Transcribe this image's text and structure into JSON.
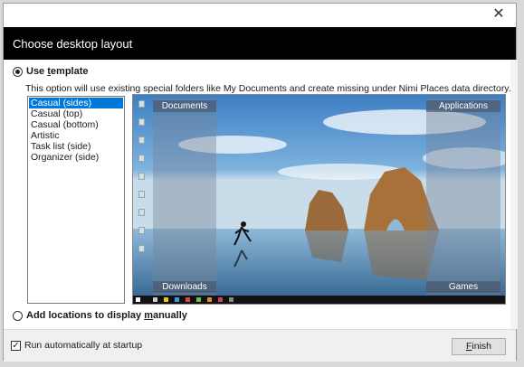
{
  "dialog": {
    "title": "Choose desktop layout"
  },
  "template_option": {
    "label_prefix": "Use ",
    "label_accel": "t",
    "label_suffix": "emplate",
    "selected": true,
    "description": "This option will use existing special folders like My Documents and create missing under Nimi Places data directory."
  },
  "layouts": {
    "items": [
      "Casual (sides)",
      "Casual (top)",
      "Casual (bottom)",
      "Artistic",
      "Task list (side)",
      "Organizer (side)"
    ],
    "selected_index": 0
  },
  "preview": {
    "zones": {
      "documents": "Documents",
      "applications": "Applications",
      "downloads": "Downloads",
      "games": "Games"
    }
  },
  "manual_option": {
    "label_prefix": "Add locations to display ",
    "label_accel": "m",
    "label_suffix": "anually",
    "selected": false
  },
  "footer": {
    "autostart_label": "Run automatically at startup",
    "autostart_checked": true,
    "finish_accel": "F",
    "finish_rest": "inish"
  },
  "icons": {
    "close": "close-icon",
    "checkmark": "checkmark-icon"
  },
  "colors": {
    "header_bg": "#000000",
    "selection": "#0078d7"
  }
}
